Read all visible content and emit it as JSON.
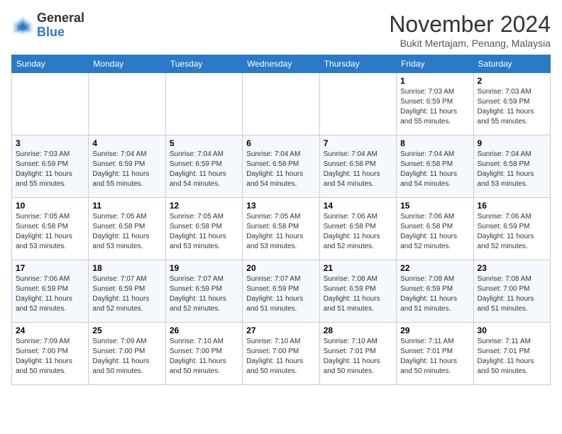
{
  "header": {
    "logo_general": "General",
    "logo_blue": "Blue",
    "month_title": "November 2024",
    "subtitle": "Bukit Mertajam, Penang, Malaysia"
  },
  "weekdays": [
    "Sunday",
    "Monday",
    "Tuesday",
    "Wednesday",
    "Thursday",
    "Friday",
    "Saturday"
  ],
  "weeks": [
    [
      {
        "day": "",
        "info": ""
      },
      {
        "day": "",
        "info": ""
      },
      {
        "day": "",
        "info": ""
      },
      {
        "day": "",
        "info": ""
      },
      {
        "day": "",
        "info": ""
      },
      {
        "day": "1",
        "info": "Sunrise: 7:03 AM\nSunset: 6:59 PM\nDaylight: 11 hours and 55 minutes."
      },
      {
        "day": "2",
        "info": "Sunrise: 7:03 AM\nSunset: 6:59 PM\nDaylight: 11 hours and 55 minutes."
      }
    ],
    [
      {
        "day": "3",
        "info": "Sunrise: 7:03 AM\nSunset: 6:59 PM\nDaylight: 11 hours and 55 minutes."
      },
      {
        "day": "4",
        "info": "Sunrise: 7:04 AM\nSunset: 6:59 PM\nDaylight: 11 hours and 55 minutes."
      },
      {
        "day": "5",
        "info": "Sunrise: 7:04 AM\nSunset: 6:59 PM\nDaylight: 11 hours and 54 minutes."
      },
      {
        "day": "6",
        "info": "Sunrise: 7:04 AM\nSunset: 6:58 PM\nDaylight: 11 hours and 54 minutes."
      },
      {
        "day": "7",
        "info": "Sunrise: 7:04 AM\nSunset: 6:58 PM\nDaylight: 11 hours and 54 minutes."
      },
      {
        "day": "8",
        "info": "Sunrise: 7:04 AM\nSunset: 6:58 PM\nDaylight: 11 hours and 54 minutes."
      },
      {
        "day": "9",
        "info": "Sunrise: 7:04 AM\nSunset: 6:58 PM\nDaylight: 11 hours and 53 minutes."
      }
    ],
    [
      {
        "day": "10",
        "info": "Sunrise: 7:05 AM\nSunset: 6:58 PM\nDaylight: 11 hours and 53 minutes."
      },
      {
        "day": "11",
        "info": "Sunrise: 7:05 AM\nSunset: 6:58 PM\nDaylight: 11 hours and 53 minutes."
      },
      {
        "day": "12",
        "info": "Sunrise: 7:05 AM\nSunset: 6:58 PM\nDaylight: 11 hours and 53 minutes."
      },
      {
        "day": "13",
        "info": "Sunrise: 7:05 AM\nSunset: 6:58 PM\nDaylight: 11 hours and 53 minutes."
      },
      {
        "day": "14",
        "info": "Sunrise: 7:06 AM\nSunset: 6:58 PM\nDaylight: 11 hours and 52 minutes."
      },
      {
        "day": "15",
        "info": "Sunrise: 7:06 AM\nSunset: 6:58 PM\nDaylight: 11 hours and 52 minutes."
      },
      {
        "day": "16",
        "info": "Sunrise: 7:06 AM\nSunset: 6:59 PM\nDaylight: 11 hours and 52 minutes."
      }
    ],
    [
      {
        "day": "17",
        "info": "Sunrise: 7:06 AM\nSunset: 6:59 PM\nDaylight: 11 hours and 52 minutes."
      },
      {
        "day": "18",
        "info": "Sunrise: 7:07 AM\nSunset: 6:59 PM\nDaylight: 11 hours and 52 minutes."
      },
      {
        "day": "19",
        "info": "Sunrise: 7:07 AM\nSunset: 6:59 PM\nDaylight: 11 hours and 52 minutes."
      },
      {
        "day": "20",
        "info": "Sunrise: 7:07 AM\nSunset: 6:59 PM\nDaylight: 11 hours and 51 minutes."
      },
      {
        "day": "21",
        "info": "Sunrise: 7:08 AM\nSunset: 6:59 PM\nDaylight: 11 hours and 51 minutes."
      },
      {
        "day": "22",
        "info": "Sunrise: 7:08 AM\nSunset: 6:59 PM\nDaylight: 11 hours and 51 minutes."
      },
      {
        "day": "23",
        "info": "Sunrise: 7:08 AM\nSunset: 7:00 PM\nDaylight: 11 hours and 51 minutes."
      }
    ],
    [
      {
        "day": "24",
        "info": "Sunrise: 7:09 AM\nSunset: 7:00 PM\nDaylight: 11 hours and 50 minutes."
      },
      {
        "day": "25",
        "info": "Sunrise: 7:09 AM\nSunset: 7:00 PM\nDaylight: 11 hours and 50 minutes."
      },
      {
        "day": "26",
        "info": "Sunrise: 7:10 AM\nSunset: 7:00 PM\nDaylight: 11 hours and 50 minutes."
      },
      {
        "day": "27",
        "info": "Sunrise: 7:10 AM\nSunset: 7:00 PM\nDaylight: 11 hours and 50 minutes."
      },
      {
        "day": "28",
        "info": "Sunrise: 7:10 AM\nSunset: 7:01 PM\nDaylight: 11 hours and 50 minutes."
      },
      {
        "day": "29",
        "info": "Sunrise: 7:11 AM\nSunset: 7:01 PM\nDaylight: 11 hours and 50 minutes."
      },
      {
        "day": "30",
        "info": "Sunrise: 7:11 AM\nSunset: 7:01 PM\nDaylight: 11 hours and 50 minutes."
      }
    ]
  ]
}
